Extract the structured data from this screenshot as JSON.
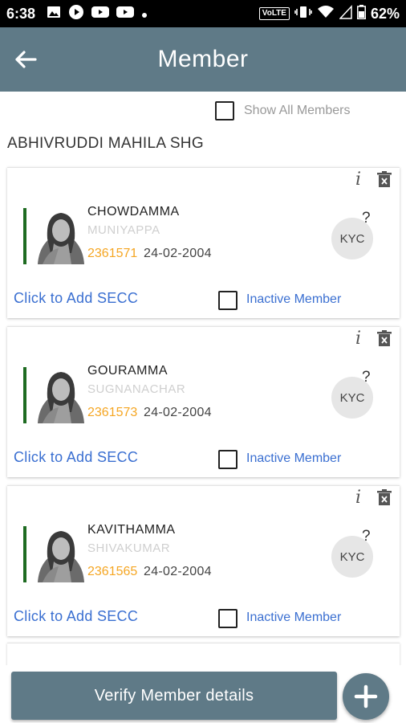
{
  "status_bar": {
    "time": "6:38",
    "battery": "62%",
    "network_badge": "VoLTE"
  },
  "app_bar": {
    "title": "Member",
    "back_icon": "arrow-back-icon"
  },
  "filter": {
    "show_all_label": "Show All Members",
    "checked": false
  },
  "group_name": "ABHIVRUDDI MAHILA SHG",
  "members": [
    {
      "name": "CHOWDAMMA",
      "guardian": "MUNIYAPPA",
      "id": "2361571",
      "date": "24-02-2004",
      "kyc_label": "KYC",
      "kyc_status": "?",
      "secc_link": "Click to Add SECC",
      "inactive_label": "Inactive Member",
      "inactive": false
    },
    {
      "name": "GOURAMMA",
      "guardian": "SUGNANACHAR",
      "id": "2361573",
      "date": "24-02-2004",
      "kyc_label": "KYC",
      "kyc_status": "?",
      "secc_link": "Click to Add SECC",
      "inactive_label": "Inactive Member",
      "inactive": false
    },
    {
      "name": "KAVITHAMMA",
      "guardian": "SHIVAKUMAR",
      "id": "2361565",
      "date": "24-02-2004",
      "kyc_label": "KYC",
      "kyc_status": "?",
      "secc_link": "Click to Add SECC",
      "inactive_label": "Inactive Member",
      "inactive": false
    }
  ],
  "bottom": {
    "verify_label": "Verify Member details",
    "add_icon": "plus-icon"
  },
  "colors": {
    "primary": "#5f7a87",
    "accent_bar": "#1e6b21",
    "member_id": "#f5a623",
    "link": "#3a6fd1"
  }
}
